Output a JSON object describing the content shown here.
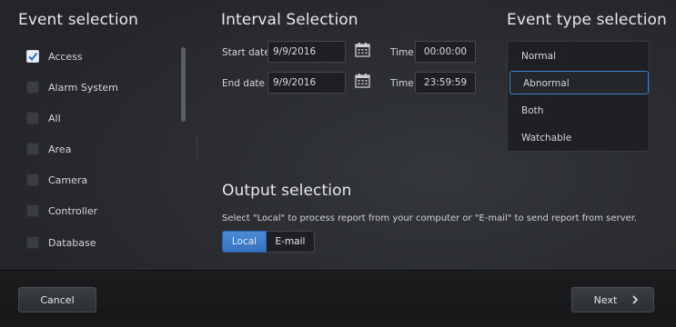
{
  "event_selection": {
    "title": "Event selection",
    "items": [
      {
        "label": "Access",
        "checked": true
      },
      {
        "label": "Alarm System",
        "checked": false
      },
      {
        "label": "All",
        "checked": false
      },
      {
        "label": "Area",
        "checked": false
      },
      {
        "label": "Camera",
        "checked": false
      },
      {
        "label": "Controller",
        "checked": false
      },
      {
        "label": "Database",
        "checked": false
      }
    ]
  },
  "interval": {
    "title": "Interval Selection",
    "start_label": "Start date",
    "start_date": "9/9/2016",
    "start_time_label": "Time",
    "start_time": "00:00:00",
    "end_label": "End date",
    "end_date": "9/9/2016",
    "end_time_label": "Time",
    "end_time": "23:59:59"
  },
  "event_type": {
    "title": "Event type selection",
    "options": [
      "Normal",
      "Abnormal",
      "Both",
      "Watchable"
    ],
    "selected": "Abnormal"
  },
  "output": {
    "title": "Output selection",
    "description": "Select \"Local\" to process report from your computer or \"E-mail\" to send report from server.",
    "local_label": "Local",
    "email_label": "E-mail",
    "selected": "Local"
  },
  "footer": {
    "cancel_label": "Cancel",
    "next_label": "Next"
  },
  "colors": {
    "accent": "#3f7fcf",
    "background": "#2a2c2f"
  }
}
